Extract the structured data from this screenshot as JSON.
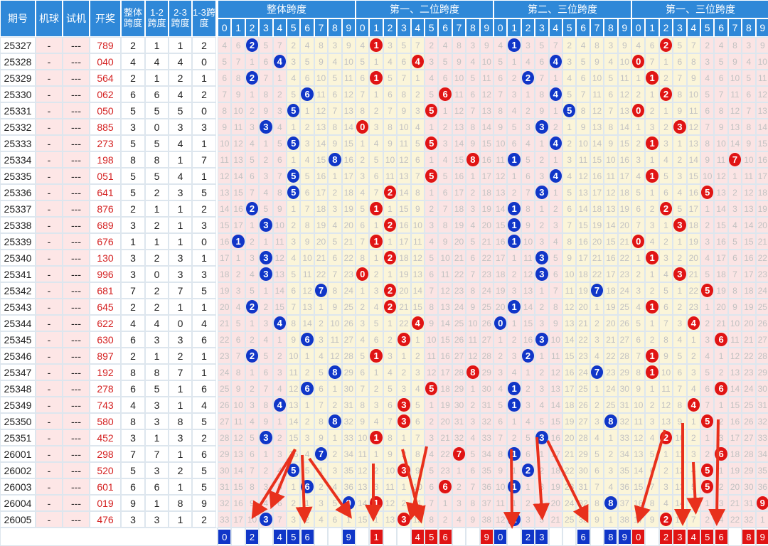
{
  "headers": {
    "period": "期号",
    "machine": "机球",
    "test": "试机",
    "prize": "开奖",
    "total_span": "整体跨度",
    "span12": "1-2跨度",
    "span23": "2-3跨度",
    "span13": "1-3跨度",
    "groups": [
      "整体跨度",
      "第一、二位跨度",
      "第二、三位跨度",
      "第一、三位跨度"
    ],
    "digits": [
      "0",
      "1",
      "2",
      "3",
      "4",
      "5",
      "6",
      "7",
      "8",
      "9"
    ]
  },
  "rows": [
    {
      "period": "25327",
      "machine": "-",
      "test": "---",
      "prize": "789",
      "total": 2,
      "s12": 1,
      "s23": 1,
      "s13": 2
    },
    {
      "period": "25328",
      "machine": "-",
      "test": "---",
      "prize": "040",
      "total": 4,
      "s12": 4,
      "s23": 4,
      "s13": 0
    },
    {
      "period": "25329",
      "machine": "-",
      "test": "---",
      "prize": "564",
      "total": 2,
      "s12": 1,
      "s23": 2,
      "s13": 1
    },
    {
      "period": "25330",
      "machine": "-",
      "test": "---",
      "prize": "062",
      "total": 6,
      "s12": 6,
      "s23": 4,
      "s13": 2
    },
    {
      "period": "25331",
      "machine": "-",
      "test": "---",
      "prize": "050",
      "total": 5,
      "s12": 5,
      "s23": 5,
      "s13": 0
    },
    {
      "period": "25332",
      "machine": "-",
      "test": "---",
      "prize": "885",
      "total": 3,
      "s12": 0,
      "s23": 3,
      "s13": 3
    },
    {
      "period": "25333",
      "machine": "-",
      "test": "---",
      "prize": "273",
      "total": 5,
      "s12": 5,
      "s23": 4,
      "s13": 1
    },
    {
      "period": "25334",
      "machine": "-",
      "test": "---",
      "prize": "198",
      "total": 8,
      "s12": 8,
      "s23": 1,
      "s13": 7
    },
    {
      "period": "25335",
      "machine": "-",
      "test": "---",
      "prize": "051",
      "total": 5,
      "s12": 5,
      "s23": 4,
      "s13": 1
    },
    {
      "period": "25336",
      "machine": "-",
      "test": "---",
      "prize": "641",
      "total": 5,
      "s12": 2,
      "s23": 3,
      "s13": 5
    },
    {
      "period": "25337",
      "machine": "-",
      "test": "---",
      "prize": "876",
      "total": 2,
      "s12": 1,
      "s23": 1,
      "s13": 2
    },
    {
      "period": "25338",
      "machine": "-",
      "test": "---",
      "prize": "689",
      "total": 3,
      "s12": 2,
      "s23": 1,
      "s13": 3
    },
    {
      "period": "25339",
      "machine": "-",
      "test": "---",
      "prize": "676",
      "total": 1,
      "s12": 1,
      "s23": 1,
      "s13": 0
    },
    {
      "period": "25340",
      "machine": "-",
      "test": "---",
      "prize": "130",
      "total": 3,
      "s12": 2,
      "s23": 3,
      "s13": 1
    },
    {
      "period": "25341",
      "machine": "-",
      "test": "---",
      "prize": "996",
      "total": 3,
      "s12": 0,
      "s23": 3,
      "s13": 3
    },
    {
      "period": "25342",
      "machine": "-",
      "test": "---",
      "prize": "681",
      "total": 7,
      "s12": 2,
      "s23": 7,
      "s13": 5
    },
    {
      "period": "25343",
      "machine": "-",
      "test": "---",
      "prize": "645",
      "total": 2,
      "s12": 2,
      "s23": 1,
      "s13": 1
    },
    {
      "period": "25344",
      "machine": "-",
      "test": "---",
      "prize": "622",
      "total": 4,
      "s12": 4,
      "s23": 0,
      "s13": 4
    },
    {
      "period": "25345",
      "machine": "-",
      "test": "---",
      "prize": "630",
      "total": 6,
      "s12": 3,
      "s23": 3,
      "s13": 6
    },
    {
      "period": "25346",
      "machine": "-",
      "test": "---",
      "prize": "897",
      "total": 2,
      "s12": 1,
      "s23": 2,
      "s13": 1
    },
    {
      "period": "25347",
      "machine": "-",
      "test": "---",
      "prize": "192",
      "total": 8,
      "s12": 8,
      "s23": 7,
      "s13": 1
    },
    {
      "period": "25348",
      "machine": "-",
      "test": "---",
      "prize": "278",
      "total": 6,
      "s12": 5,
      "s23": 1,
      "s13": 6
    },
    {
      "period": "25349",
      "machine": "-",
      "test": "---",
      "prize": "743",
      "total": 4,
      "s12": 3,
      "s23": 1,
      "s13": 4
    },
    {
      "period": "25350",
      "machine": "-",
      "test": "---",
      "prize": "580",
      "total": 8,
      "s12": 3,
      "s23": 8,
      "s13": 5
    },
    {
      "period": "25351",
      "machine": "-",
      "test": "---",
      "prize": "452",
      "total": 3,
      "s12": 1,
      "s23": 3,
      "s13": 2
    },
    {
      "period": "26001",
      "machine": "-",
      "test": "---",
      "prize": "298",
      "total": 7,
      "s12": 7,
      "s23": 1,
      "s13": 6
    },
    {
      "period": "26002",
      "machine": "-",
      "test": "---",
      "prize": "520",
      "total": 5,
      "s12": 3,
      "s23": 2,
      "s13": 5
    },
    {
      "period": "26003",
      "machine": "-",
      "test": "---",
      "prize": "601",
      "total": 6,
      "s12": 6,
      "s23": 1,
      "s13": 5
    },
    {
      "period": "26004",
      "machine": "-",
      "test": "---",
      "prize": "019",
      "total": 9,
      "s12": 1,
      "s23": 8,
      "s13": 9
    },
    {
      "period": "26005",
      "machine": "-",
      "test": "---",
      "prize": "476",
      "total": 3,
      "s12": 3,
      "s23": 1,
      "s13": 2
    }
  ],
  "footer": {
    "total": [
      0,
      2,
      4,
      5,
      6,
      9
    ],
    "s12": [
      1,
      4,
      5,
      6,
      9
    ],
    "s23": [
      0,
      2,
      3,
      6,
      8,
      9
    ],
    "s13": [
      0,
      2,
      3,
      4,
      5,
      6,
      8,
      9
    ]
  },
  "colors": {
    "header": "#2f88d8",
    "ball_blue": "#1036c8",
    "ball_red": "#e01414",
    "prize_text": "#d42020",
    "arrow": "#e8301c"
  }
}
